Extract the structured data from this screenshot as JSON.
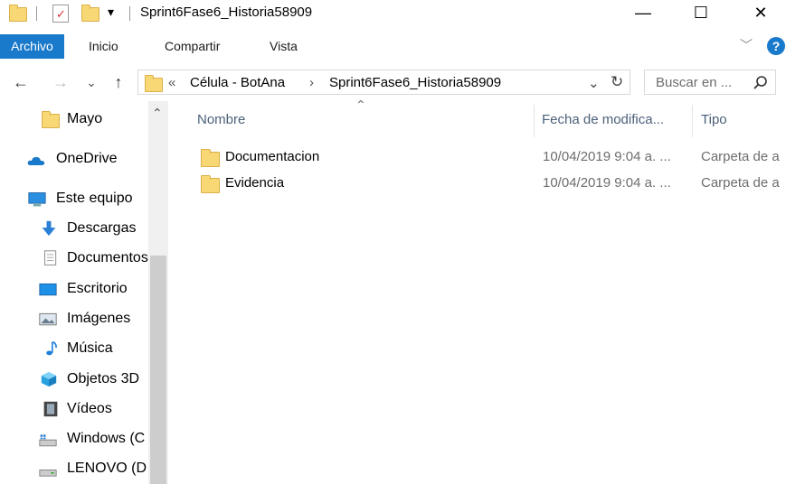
{
  "window": {
    "title": "Sprint6Fase6_Historia58909",
    "minimize_glyph": "—",
    "maximize_glyph": "☐",
    "close_glyph": "✕"
  },
  "quick_access": {
    "customize_glyph": "▾"
  },
  "ribbon": {
    "tabs": [
      "Archivo",
      "Inicio",
      "Compartir",
      "Vista"
    ],
    "help_glyph": "?",
    "expand_glyph": "﹀"
  },
  "navigation": {
    "back_glyph": "←",
    "forward_glyph": "→",
    "recent_glyph": "⌄",
    "up_glyph": "↑",
    "overflow_glyph": "«",
    "breadcrumbs": [
      "Célula - BotAna",
      "Sprint6Fase6_Historia58909"
    ],
    "crumb_sep_glyph": "›",
    "dropdown_glyph": "⌄",
    "refresh_glyph": "↻",
    "search_placeholder": "Buscar en ...",
    "search_icon": "search-icon"
  },
  "nav_pane": {
    "items": [
      {
        "label": "Mayo",
        "icon": "folder-icon"
      },
      {
        "label": "OneDrive",
        "icon": "onedrive-icon"
      },
      {
        "label": "Este equipo",
        "icon": "computer-icon"
      },
      {
        "label": "Descargas",
        "icon": "downloads-icon"
      },
      {
        "label": "Documentos",
        "icon": "documents-icon"
      },
      {
        "label": "Escritorio",
        "icon": "desktop-icon"
      },
      {
        "label": "Imágenes",
        "icon": "pictures-icon"
      },
      {
        "label": "Música",
        "icon": "music-icon"
      },
      {
        "label": "Objetos 3D",
        "icon": "3d-objects-icon"
      },
      {
        "label": "Vídeos",
        "icon": "videos-icon"
      },
      {
        "label": "Windows (C",
        "icon": "drive-c-icon"
      },
      {
        "label": "LENOVO (D",
        "icon": "drive-d-icon"
      }
    ],
    "scroll_up_glyph": "⌃"
  },
  "file_list": {
    "sort_glyph": "⌃",
    "columns": [
      "Nombre",
      "Fecha de modifica...",
      "Tipo"
    ],
    "rows": [
      {
        "name": "Documentacion",
        "date": "10/04/2019 9:04 a. ...",
        "type": "Carpeta de a"
      },
      {
        "name": "Evidencia",
        "date": "10/04/2019 9:04 a. ...",
        "type": "Carpeta de a"
      }
    ]
  },
  "colors": {
    "accent": "#1979ca",
    "folder": "#f8d775",
    "header_text": "#4c607a"
  }
}
